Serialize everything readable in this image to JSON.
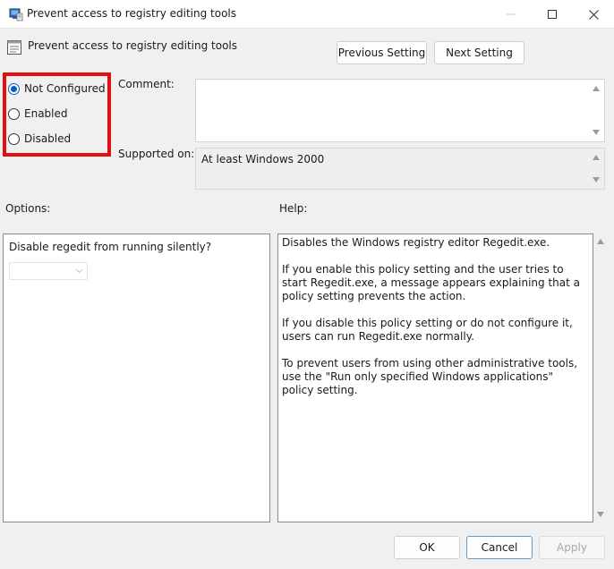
{
  "window": {
    "title": "Prevent access to registry editing tools"
  },
  "header": {
    "policy_name": "Prevent access to registry editing tools",
    "previous_label": "Previous Setting",
    "next_label": "Next Setting"
  },
  "state": {
    "options": [
      {
        "label": "Not Configured",
        "checked": true
      },
      {
        "label": "Enabled",
        "checked": false
      },
      {
        "label": "Disabled",
        "checked": false
      }
    ],
    "highlight_color": "#e01010",
    "selected_color": "#0a5bc4"
  },
  "comment": {
    "label": "Comment:",
    "value": ""
  },
  "supported": {
    "label": "Supported on:",
    "value": "At least Windows 2000"
  },
  "options_section": {
    "label": "Options:",
    "question": "Disable regedit from running silently?",
    "selected_value": ""
  },
  "help_section": {
    "label": "Help:",
    "paragraphs": [
      "Disables the Windows registry editor Regedit.exe.",
      "If you enable this policy setting and the user tries to start Regedit.exe, a message appears explaining that a policy setting prevents the action.",
      "If you disable this policy setting or do not configure it, users can run Regedit.exe normally.",
      "To prevent users from using other administrative tools, use the \"Run only specified Windows applications\" policy setting."
    ]
  },
  "footer": {
    "ok_label": "OK",
    "cancel_label": "Cancel",
    "apply_label": "Apply"
  }
}
